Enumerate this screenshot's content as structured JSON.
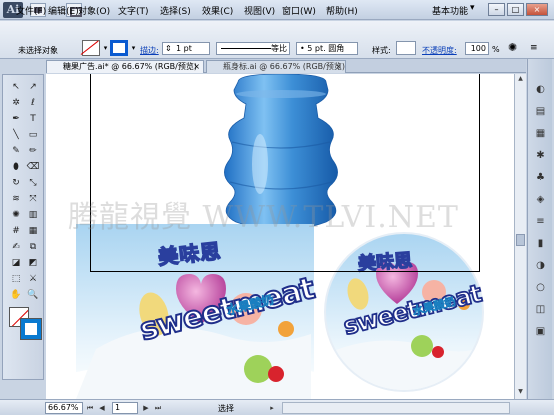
{
  "window": {
    "app_logo": "Ai",
    "menu": [
      "文件(F)",
      "编辑(E)",
      "对象(O)",
      "文字(T)",
      "选择(S)",
      "效果(C)",
      "视图(V)",
      "窗口(W)",
      "帮助(H)"
    ],
    "workspace": "基本功能",
    "win_min": "–",
    "win_max": "□",
    "win_close": "×"
  },
  "control_bar": {
    "selection_status": "未选择对象",
    "stroke_link": "描边:",
    "stroke_weight": "1 pt",
    "profile": "等比",
    "brush": "• 5 pt. 圆角",
    "style_label": "样式:",
    "opacity_link": "不透明度:",
    "opacity_value": "100",
    "opacity_unit": "%"
  },
  "tabs": [
    {
      "label": "糖果广告.ai* @ 66.67% (RGB/预览)",
      "close": "×"
    },
    {
      "label": "瓶身标.ai @ 66.67% (RGB/预览)",
      "close": "×"
    }
  ],
  "artwork": {
    "brand_cn": "美味思",
    "brand_en": "sweetmeat",
    "flavor": "水果酸奶",
    "bottle_color": "#3d8fd6",
    "sky_color": "#a9d4f1"
  },
  "watermark": "腾龍視覺 WWW.TLVI.NET",
  "status_bar": {
    "zoom": "66.67%",
    "page": "1",
    "status": "选择"
  },
  "tools": [
    "selection-tool",
    "direct-selection-tool",
    "magic-wand-tool",
    "lasso-tool",
    "pen-tool",
    "type-tool",
    "line-tool",
    "rectangle-tool",
    "paintbrush-tool",
    "pencil-tool",
    "blob-brush-tool",
    "eraser-tool",
    "rotate-tool",
    "scale-tool",
    "width-tool",
    "free-transform-tool",
    "symbol-sprayer-tool",
    "column-graph-tool",
    "mesh-tool",
    "gradient-tool",
    "eyedropper-tool",
    "blend-tool",
    "live-paint-tool",
    "live-paint-selection-tool",
    "artboard-tool",
    "slice-tool",
    "hand-tool",
    "zoom-tool"
  ],
  "tool_glyphs": [
    "↖",
    "↗",
    "✲",
    "ℓ",
    "✒",
    "T",
    "╲",
    "▭",
    "✎",
    "✏",
    "⬮",
    "⌫",
    "↻",
    "⤡",
    "≋",
    "⤧",
    "✺",
    "▥",
    "#",
    "▦",
    "✍",
    "⧉",
    "◪",
    "◩",
    "⬚",
    "⚔",
    "✋",
    "🔍"
  ],
  "dock_icons": [
    "color-icon",
    "color-guide-icon",
    "swatches-icon",
    "brushes-icon",
    "symbols-icon",
    "graphic-styles-icon",
    "stroke-icon",
    "gradient-icon",
    "transparency-icon",
    "appearance-icon",
    "layers-icon",
    "artboards-icon"
  ],
  "dock_glyphs": [
    "◐",
    "▤",
    "▦",
    "✱",
    "♣",
    "◈",
    "≡",
    "▮",
    "◑",
    "○",
    "◫",
    "▣"
  ]
}
